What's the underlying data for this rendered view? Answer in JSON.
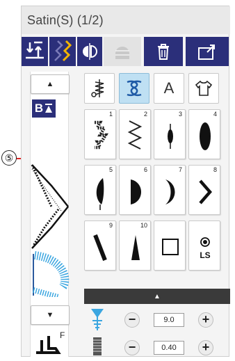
{
  "callout": {
    "label": "⑤"
  },
  "screen": {
    "title": "Satin(S) (1/2)",
    "toolbar": {
      "icons": [
        "needle-up-down-icon",
        "twin-needle-icon",
        "elongation-icon",
        "mirror-icon",
        "clear-icon",
        "delete-icon",
        "save-icon"
      ]
    },
    "left": {
      "scroll_up": "▲",
      "scroll_down": "▼",
      "b_badge": "B",
      "foot_letter": "F"
    },
    "tabs": [
      {
        "id": "utility",
        "label": ""
      },
      {
        "id": "satin",
        "label": "",
        "active": true
      },
      {
        "id": "alphabet",
        "label": "A"
      },
      {
        "id": "applique",
        "label": ""
      }
    ],
    "stitches": [
      {
        "num": "1"
      },
      {
        "num": "2"
      },
      {
        "num": "3"
      },
      {
        "num": "4"
      },
      {
        "num": "5"
      },
      {
        "num": "6"
      },
      {
        "num": "7"
      },
      {
        "num": "8"
      },
      {
        "num": "9"
      },
      {
        "num": "10"
      },
      {
        "num": ""
      },
      {
        "num": "",
        "label": "LS"
      }
    ],
    "panel": {
      "up_arrow": "▲",
      "width_value": "9.0",
      "length_value": "0.40",
      "minus": "−",
      "plus": "+"
    }
  }
}
